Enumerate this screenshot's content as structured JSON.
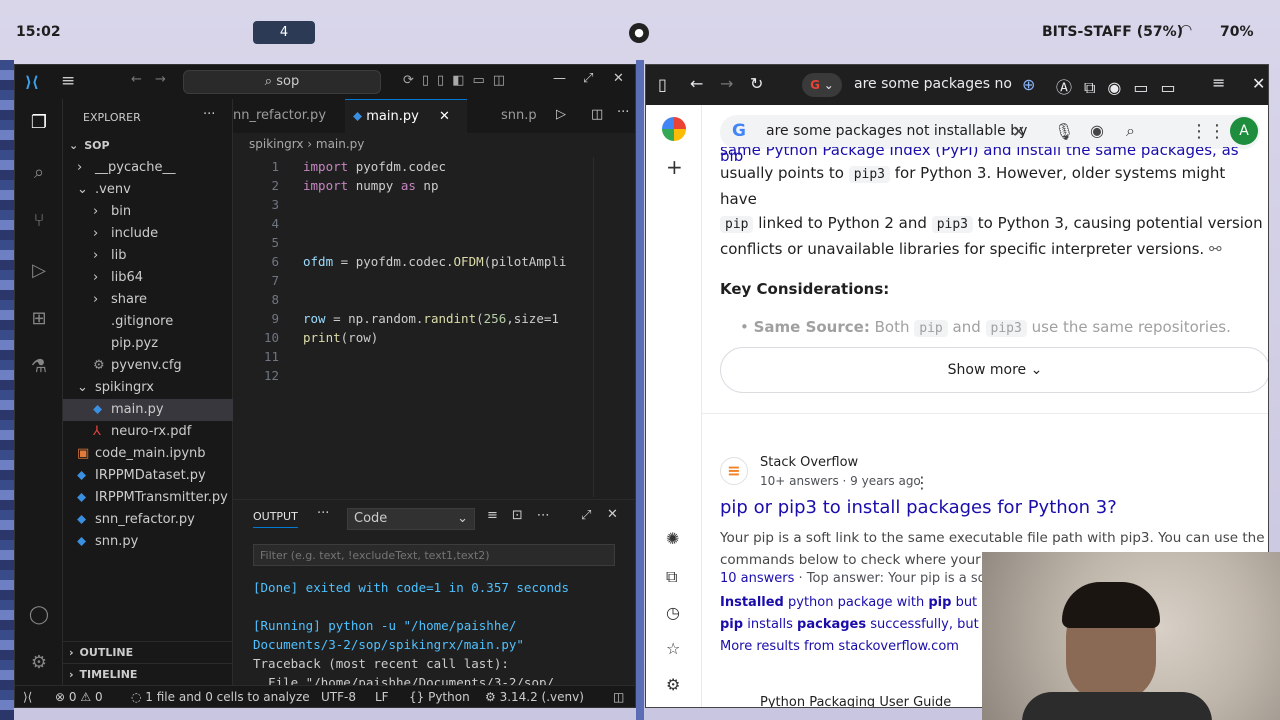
{
  "topbar": {
    "time": "15:02",
    "workspace": "4",
    "network": "BITS-STAFF (57%)",
    "battery": "70%"
  },
  "vscode": {
    "search": "sop",
    "tabs": [
      "nn_refactor.py",
      "main.py",
      "snn.p"
    ],
    "breadcrumb": [
      "spikingrx",
      "main.py"
    ],
    "explorer": {
      "title": "EXPLORER",
      "root": "SOP",
      "items": [
        {
          "label": "__pycache__",
          "depth": 1,
          "kind": "folder-closed"
        },
        {
          "label": ".venv",
          "depth": 1,
          "kind": "folder-open"
        },
        {
          "label": "bin",
          "depth": 2,
          "kind": "folder-closed"
        },
        {
          "label": "include",
          "depth": 2,
          "kind": "folder-closed"
        },
        {
          "label": "lib",
          "depth": 2,
          "kind": "folder-closed"
        },
        {
          "label": "lib64",
          "depth": 2,
          "kind": "folder-closed"
        },
        {
          "label": "share",
          "depth": 2,
          "kind": "folder-closed"
        },
        {
          "label": ".gitignore",
          "depth": 2,
          "kind": "file"
        },
        {
          "label": "pip.pyz",
          "depth": 2,
          "kind": "file"
        },
        {
          "label": "pyvenv.cfg",
          "depth": 2,
          "kind": "gear-file"
        },
        {
          "label": "spikingrx",
          "depth": 1,
          "kind": "folder-open"
        },
        {
          "label": "main.py",
          "depth": 2,
          "kind": "py"
        },
        {
          "label": "neuro-rx.pdf",
          "depth": 2,
          "kind": "pdf"
        },
        {
          "label": "code_main.ipynb",
          "depth": 1,
          "kind": "nb"
        },
        {
          "label": "IRPPMDataset.py",
          "depth": 1,
          "kind": "py"
        },
        {
          "label": "IRPPMTransmitter.py",
          "depth": 1,
          "kind": "py"
        },
        {
          "label": "snn_refactor.py",
          "depth": 1,
          "kind": "py"
        },
        {
          "label": "snn.py",
          "depth": 1,
          "kind": "py"
        }
      ],
      "outline": "OUTLINE",
      "timeline": "TIMELINE"
    },
    "code": [
      {
        "n": "1",
        "t": [
          [
            "kw",
            "import "
          ],
          [
            "plain",
            "pyofdm.codec"
          ]
        ]
      },
      {
        "n": "2",
        "t": [
          [
            "kw",
            "import "
          ],
          [
            "plain",
            "numpy "
          ],
          [
            "kw",
            "as "
          ],
          [
            "plain",
            "np"
          ]
        ]
      },
      {
        "n": "3",
        "t": []
      },
      {
        "n": "4",
        "t": []
      },
      {
        "n": "5",
        "t": []
      },
      {
        "n": "6",
        "t": [
          [
            "vr",
            "ofdm "
          ],
          [
            "plain",
            "= pyofdm.codec."
          ],
          [
            "fn",
            "OFDM"
          ],
          [
            "plain",
            "(pilotAmpli"
          ]
        ]
      },
      {
        "n": "7",
        "t": []
      },
      {
        "n": "8",
        "t": []
      },
      {
        "n": "9",
        "t": [
          [
            "vr",
            "row "
          ],
          [
            "plain",
            "= np.random."
          ],
          [
            "fn",
            "randint"
          ],
          [
            "plain",
            "("
          ],
          [
            "num",
            "256"
          ],
          [
            "plain",
            ",size=1"
          ]
        ]
      },
      {
        "n": "10",
        "t": [
          [
            "fn",
            "print"
          ],
          [
            "plain",
            "(row)"
          ]
        ]
      },
      {
        "n": "11",
        "t": []
      },
      {
        "n": "12",
        "t": []
      }
    ],
    "panel": {
      "tab": "OUTPUT",
      "channel": "Code",
      "filter_placeholder": "Filter (e.g. text, !excludeText, text1,text2)",
      "lines": [
        {
          "c": "#4fc1ff",
          "t": "[Done] exited with code=1 in 0.357 seconds"
        },
        {
          "c": "#cccccc",
          "t": ""
        },
        {
          "c": "#4fc1ff",
          "t": "[Running] python -u \"/home/paishhe/"
        },
        {
          "c": "#4fc1ff",
          "t": "Documents/3-2/sop/spikingrx/main.py\""
        },
        {
          "c": "#cccccc",
          "t": "Traceback (most recent call last):"
        },
        {
          "c": "#cccccc",
          "t": "  File \"/home/paishhe/Documents/3-2/sop/"
        }
      ]
    },
    "status": {
      "errors": "0",
      "warnings": "0",
      "analyze": "1 file and 0 cells to analyze",
      "encoding": "UTF-8",
      "eol": "LF",
      "lang": "Python",
      "python": "3.14.2 (.venv)"
    }
  },
  "chrome": {
    "address": "are some packages no",
    "search_query": "are some packages not installable by",
    "ai": {
      "frag_top": "same Python Package Index (PyPI) and install the same packages, as pip",
      "p1": "usually points to",
      "p1code": "pip3",
      "p1b": "for Python 3. However, older systems might have",
      "p2code": "pip",
      "p2": "linked to Python 2 and",
      "p2code2": "pip3",
      "p2b": "to Python 3, causing potential version",
      "p3": "conflicts or unavailable libraries for specific interpreter versions.",
      "heading": "Key Considerations:",
      "bullet_bold": "Same Source:",
      "bullet": "Both",
      "bcode1": "pip",
      "band": "and",
      "bcode2": "pip3",
      "bend": "use the same repositories.",
      "show_more": "Show more"
    },
    "result": {
      "site": "Stack Overflow",
      "meta": "10+ answers · 9 years ago",
      "title": "pip or pip3 to install packages for Python 3?",
      "snippet1": "Your pip is a soft link to the same executable file path with pip3. You can use the",
      "snippet2": "commands below to check where your pip",
      "answers": "10 answers",
      "top": "· Top answer: Your pip is a sof",
      "rel1a": "Installed",
      "rel1b": "python package with",
      "rel1c": "pip",
      "rel1d": "but can",
      "rel2a": "pip",
      "rel2b": "installs",
      "rel2c": "packages",
      "rel2d": "successfully, but exe",
      "more": "More results from stackoverflow.com"
    },
    "result2": {
      "site": "Python Packaging User Guide"
    }
  }
}
